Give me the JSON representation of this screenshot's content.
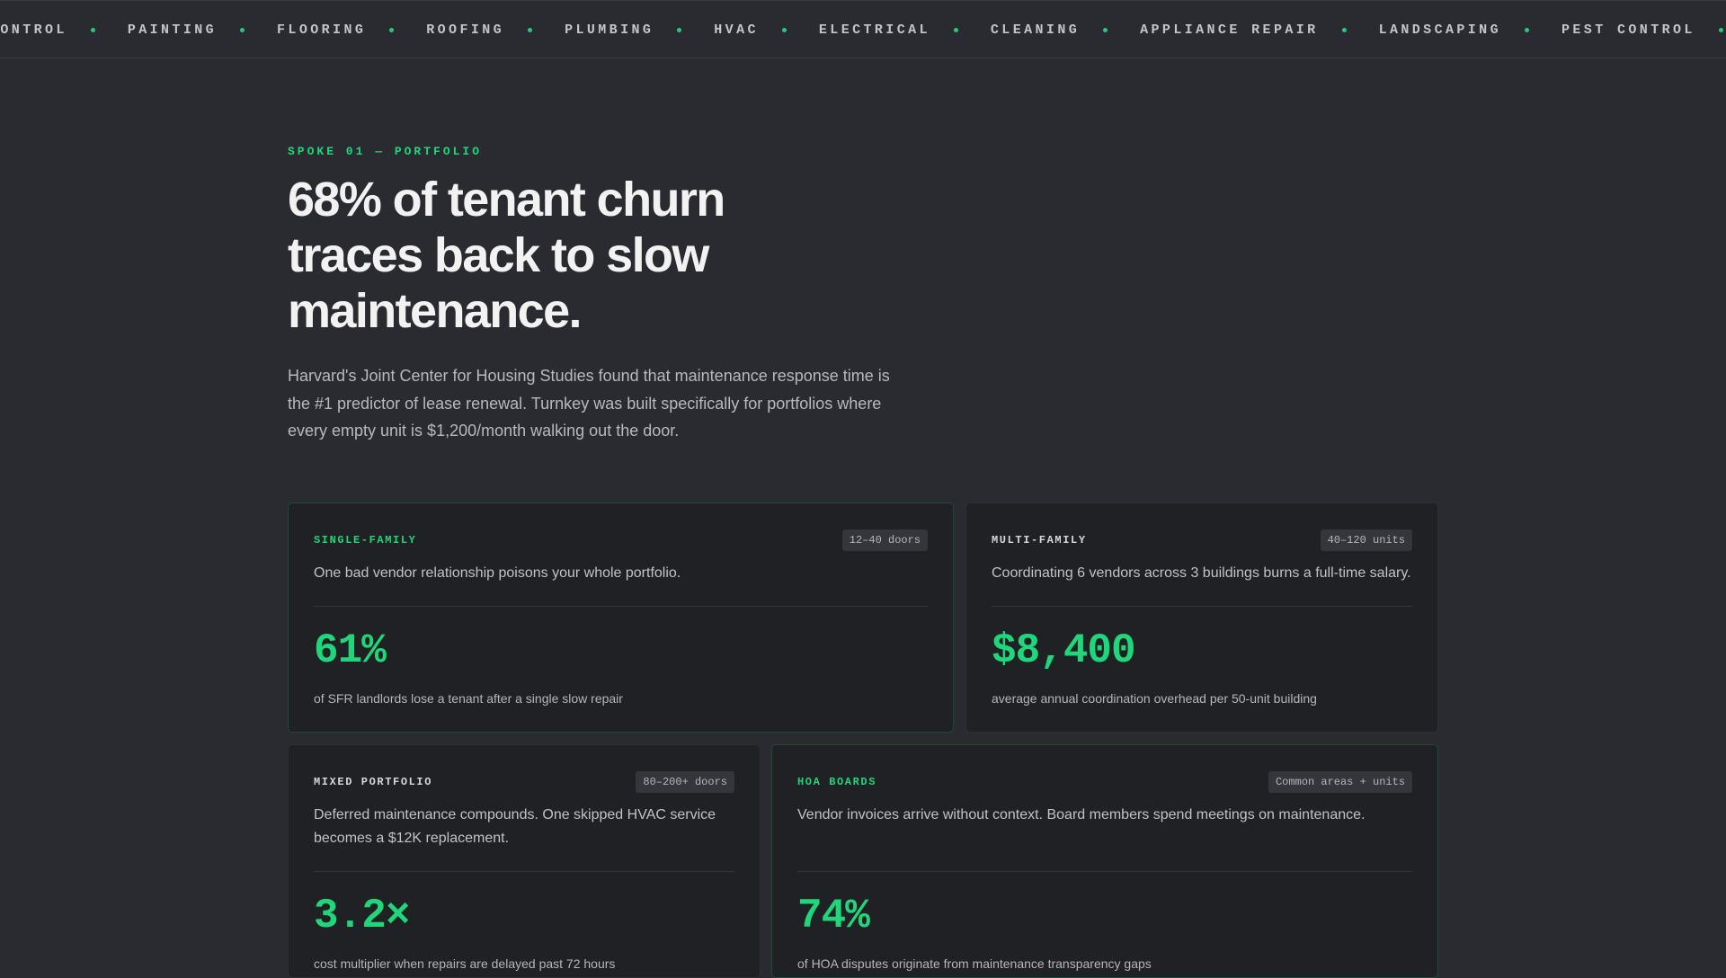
{
  "ticker": {
    "items": [
      "CONTROL",
      "PAINTING",
      "FLOORING",
      "ROOFING",
      "PLUMBING",
      "HVAC",
      "ELECTRICAL",
      "CLEANING",
      "APPLIANCE REPAIR",
      "LANDSCAPING",
      "PEST CONTROL"
    ]
  },
  "hero": {
    "eyebrow": "SPOKE 01 — PORTFOLIO",
    "headline": "68% of tenant churn traces back to slow maintenance.",
    "lede": "Harvard's Joint Center for Housing Studies found that maintenance response time is the #1 predictor of lease renewal. Turnkey was built specifically for portfolios where every empty unit is $1,200/month walking out the door."
  },
  "cards": [
    {
      "label": "SINGLE-FAMILY",
      "badge": "12–40 doors",
      "desc": "One bad vendor relationship poisons your whole portfolio.",
      "stat": "61%",
      "note": "of SFR landlords lose a tenant after a single slow repair"
    },
    {
      "label": "MULTI-FAMILY",
      "badge": "40–120 units",
      "desc": "Coordinating 6 vendors across 3 buildings burns a full-time salary.",
      "stat": "$8,400",
      "note": "average annual coordination overhead per 50-unit building"
    },
    {
      "label": "MIXED PORTFOLIO",
      "badge": "80–200+ doors",
      "desc": "Deferred maintenance compounds. One skipped HVAC service becomes a $12K replacement.",
      "stat": "3.2×",
      "note": "cost multiplier when repairs are delayed past 72 hours"
    },
    {
      "label": "HOA BOARDS",
      "badge": "Common areas + units",
      "desc": "Vendor invoices arrive without context. Board members spend meetings on maintenance.",
      "stat": "74%",
      "note": "of HOA disputes originate from maintenance transparency gaps"
    }
  ],
  "colors": {
    "accent": "#1fd67a",
    "background": "#2a2b30",
    "card": "#202125"
  }
}
